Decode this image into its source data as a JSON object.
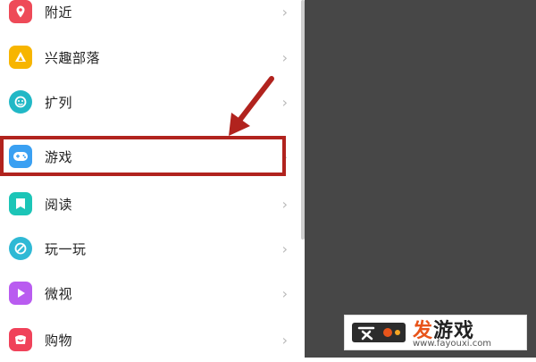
{
  "menu": {
    "items": [
      {
        "label": "附近",
        "icon": "location-pin-icon",
        "color": "#ee4a58"
      },
      {
        "label": "兴趣部落",
        "icon": "tribe-triangle-icon",
        "color": "#f7b500"
      },
      {
        "label": "扩列",
        "icon": "friends-expand-icon",
        "color": "#21b8c6"
      },
      {
        "label": "游戏",
        "icon": "gamepad-icon",
        "color": "#3aa0f2"
      },
      {
        "label": "阅读",
        "icon": "book-icon",
        "color": "#1cc5b7"
      },
      {
        "label": "玩一玩",
        "icon": "play-icon",
        "color": "#2fb9d5"
      },
      {
        "label": "微视",
        "icon": "video-play-icon",
        "color": "#b95cf0"
      },
      {
        "label": "购物",
        "icon": "shopping-bag-icon",
        "color": "#f0425a"
      }
    ],
    "chevron": "›",
    "highlighted_index": 3,
    "highlight_color": "#b1231e"
  },
  "watermark": {
    "title_accent": "发",
    "title_rest": "游戏",
    "url": "www.fayouxi.com"
  }
}
